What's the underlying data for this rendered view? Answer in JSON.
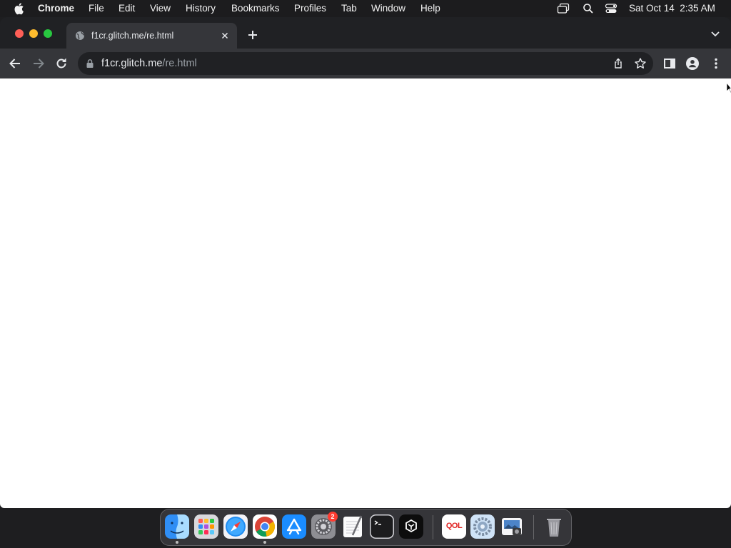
{
  "menubar": {
    "app_name": "Chrome",
    "menus": [
      "File",
      "Edit",
      "View",
      "History",
      "Bookmarks",
      "Profiles",
      "Tab",
      "Window",
      "Help"
    ],
    "datetime": "Sat Oct 14  2:35 AM",
    "status_icons": [
      "screen-mirroring-icon",
      "spotlight-search-icon",
      "control-center-icon"
    ]
  },
  "window": {
    "traffic_lights": {
      "close": "#ff5f57",
      "minimize": "#febc2e",
      "zoom": "#28c840"
    }
  },
  "tab": {
    "title": "f1cr.glitch.me/re.html",
    "icon": "globe-icon"
  },
  "toolbar": {
    "url_host": "f1cr.glitch.me",
    "url_path": "/re.html"
  },
  "dock": {
    "apps": [
      {
        "name": "Finder",
        "icon": "finder-icon",
        "running": true
      },
      {
        "name": "Launchpad",
        "icon": "launchpad-icon",
        "running": false
      },
      {
        "name": "Safari",
        "icon": "safari-icon",
        "running": false
      },
      {
        "name": "Google Chrome",
        "icon": "chrome-icon",
        "running": true
      },
      {
        "name": "App Store",
        "icon": "app-store-icon",
        "running": false
      },
      {
        "name": "System Settings",
        "icon": "system-settings-icon",
        "running": false,
        "badge": "2"
      },
      {
        "name": "TextEdit",
        "icon": "textedit-icon",
        "running": false
      },
      {
        "name": "Terminal",
        "icon": "terminal-icon",
        "running": false
      },
      {
        "name": "ChatGPT",
        "icon": "chatgpt-icon",
        "running": false
      },
      {
        "name": "QOL",
        "icon": "qol-icon",
        "running": false,
        "label": "QOL"
      },
      {
        "name": "Utility",
        "icon": "utility-gear-icon",
        "running": false
      },
      {
        "name": "Preview",
        "icon": "preview-icon",
        "running": false
      },
      {
        "name": "Trash",
        "icon": "trash-icon",
        "running": false
      }
    ]
  }
}
